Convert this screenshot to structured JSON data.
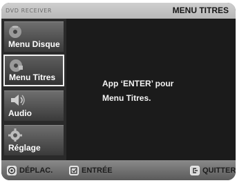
{
  "header": {
    "brand": "DVD RECEIVER",
    "title": "MENU TITRES"
  },
  "sidebar": {
    "items": [
      {
        "label": "Menu Disque",
        "icon": "disc-menu-icon",
        "selected": false
      },
      {
        "label": "Menu Titres",
        "icon": "title-menu-icon",
        "selected": true
      },
      {
        "label": "Audio",
        "icon": "speaker-icon",
        "selected": false
      },
      {
        "label": "Réglage",
        "icon": "settings-icon",
        "selected": false
      }
    ]
  },
  "main": {
    "line1": "App ‘ENTER’ pour",
    "line2": "Menu Titres."
  },
  "footer": {
    "move": "DÉPLAC.",
    "enter": "ENTRÉE",
    "quit": "QUITTER"
  }
}
